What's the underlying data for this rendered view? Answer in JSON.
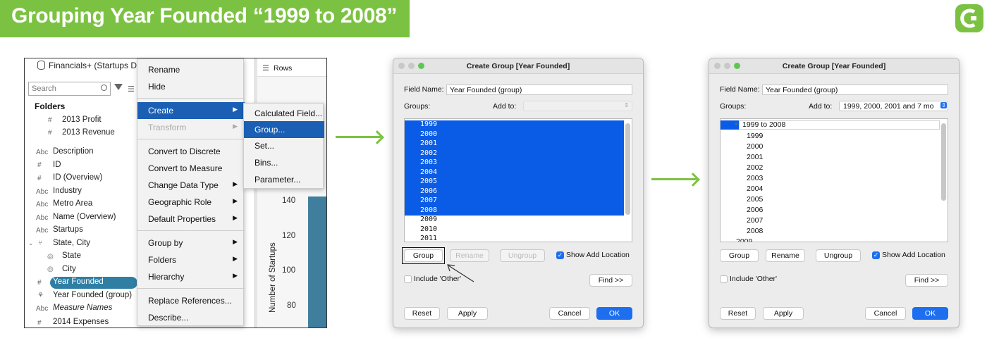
{
  "header": {
    "title": "Grouping Year Founded “1999 to 2008”",
    "logo_icon": "brand-logo-icon",
    "accent": "#7cc242"
  },
  "panel1": {
    "datasource": "Financials+ (Startups Da...",
    "search_placeholder": "Search",
    "folders_label": "Folders",
    "fields": [
      {
        "icon": "#",
        "label": "2013 Profit"
      },
      {
        "icon": "#",
        "label": "2013 Revenue"
      },
      {
        "icon": "Abc",
        "label": "Description"
      },
      {
        "icon": "#",
        "label": "ID"
      },
      {
        "icon": "#",
        "label": "ID (Overview)"
      },
      {
        "icon": "Abc",
        "label": "Industry"
      },
      {
        "icon": "Abc",
        "label": "Metro Area"
      },
      {
        "icon": "Abc",
        "label": "Name (Overview)"
      },
      {
        "icon": "Abc",
        "label": "Startups"
      },
      {
        "icon": "⑂",
        "label": "State, City"
      },
      {
        "icon": "◎",
        "label": "State"
      },
      {
        "icon": "◎",
        "label": "City"
      },
      {
        "icon": "#",
        "label": "Year Founded"
      },
      {
        "icon": "⚘",
        "label": "Year Founded (group)"
      },
      {
        "icon": "Abc",
        "label": "Measure Names"
      },
      {
        "icon": "#",
        "label": "2014 Expenses"
      }
    ],
    "rows_label": "Rows",
    "axis_ticks": [
      "140",
      "120",
      "100",
      "80"
    ],
    "y_axis_label": "Number of Startups",
    "context_menu": {
      "items": [
        "Rename",
        "Hide",
        "Create",
        "Transform",
        "Convert to Discrete",
        "Convert to Measure",
        "Change Data Type",
        "Geographic Role",
        "Default Properties",
        "Group by",
        "Folders",
        "Hierarchy",
        "Replace References...",
        "Describe..."
      ]
    },
    "create_submenu": {
      "items": [
        "Calculated Field...",
        "Group...",
        "Set...",
        "Bins...",
        "Parameter..."
      ]
    }
  },
  "dialog_before": {
    "title": "Create Group [Year Founded]",
    "field_name_label": "Field Name:",
    "field_name_value": "Year Founded (group)",
    "groups_label": "Groups:",
    "add_to_label": "Add to:",
    "add_to_value": "",
    "list_items": [
      "1999",
      "2000",
      "2001",
      "2002",
      "2003",
      "2004",
      "2005",
      "2006",
      "2007",
      "2008",
      "2009",
      "2010",
      "2011"
    ],
    "selected_count": 10,
    "buttons": {
      "group": "Group",
      "rename": "Rename",
      "ungroup": "Ungroup",
      "find": "Find >>",
      "reset": "Reset",
      "apply": "Apply",
      "cancel": "Cancel",
      "ok": "OK"
    },
    "show_add_location": "Show Add Location",
    "include_other": "Include 'Other'"
  },
  "dialog_after": {
    "title": "Create Group [Year Founded]",
    "field_name_label": "Field Name:",
    "field_name_value": "Year Founded (group)",
    "groups_label": "Groups:",
    "add_to_label": "Add to:",
    "add_to_value": "1999, 2000, 2001 and 7 mo",
    "group_name": "1999 to 2008",
    "members": [
      "1999",
      "2000",
      "2001",
      "2002",
      "2003",
      "2004",
      "2005",
      "2006",
      "2007",
      "2008"
    ],
    "partial_item": "2009",
    "buttons": {
      "group": "Group",
      "rename": "Rename",
      "ungroup": "Ungroup",
      "find": "Find >>",
      "reset": "Reset",
      "apply": "Apply",
      "cancel": "Cancel",
      "ok": "OK"
    },
    "show_add_location": "Show Add Location",
    "include_other": "Include 'Other'"
  }
}
